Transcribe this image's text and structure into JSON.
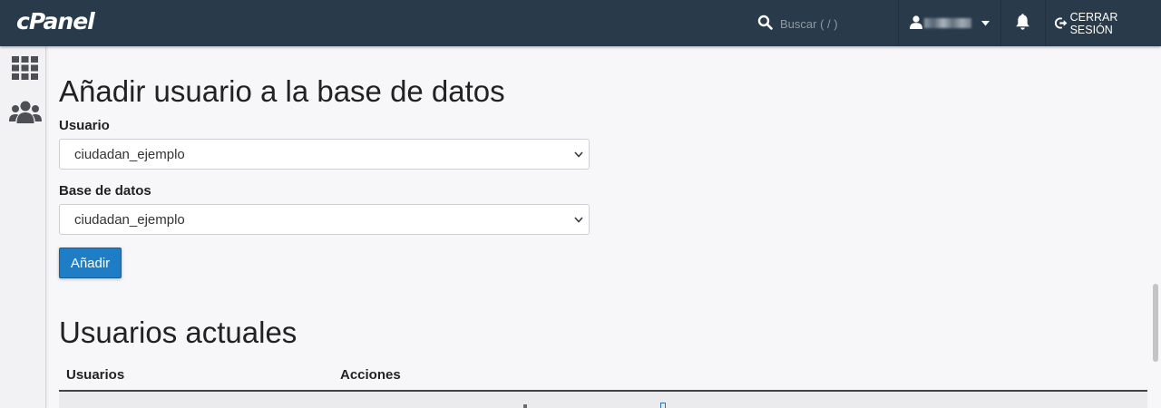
{
  "header": {
    "logo": "cPanel",
    "search_placeholder": "Buscar ( / )",
    "logout_label": "CERRAR SESIÓN"
  },
  "main": {
    "add_title": "Añadir usuario a la base de datos",
    "user_label": "Usuario",
    "user_value": "ciudadan_ejemplo",
    "db_label": "Base de datos",
    "db_value": "ciudadan_ejemplo",
    "add_button": "Añadir",
    "current_title": "Usuarios actuales",
    "table": {
      "headers": [
        "Usuarios",
        "Acciones"
      ]
    }
  },
  "icons": {
    "sidebar": [
      "grid-icon",
      "users-icon"
    ],
    "header": [
      "search-icon",
      "user-icon",
      "caret-down-icon",
      "bell-icon",
      "logout-icon"
    ]
  },
  "colors": {
    "header_bg": "#293a4a",
    "primary_button": "#1f7dc6",
    "page_bg": "#f7f6f9"
  }
}
